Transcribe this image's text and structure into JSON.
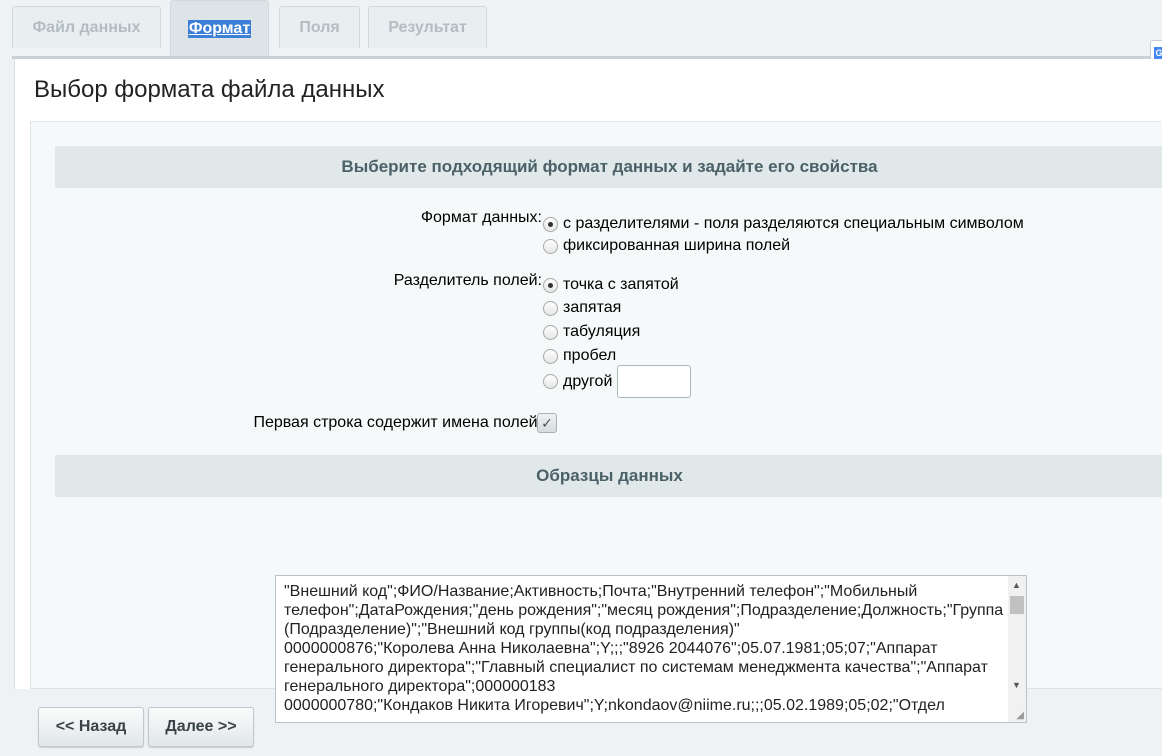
{
  "tabs": [
    {
      "label": "Файл данных",
      "active": false
    },
    {
      "label": "Формат",
      "active": true
    },
    {
      "label": "Поля",
      "active": false
    },
    {
      "label": "Результат",
      "active": false
    }
  ],
  "page": {
    "title": "Выбор формата файла данных"
  },
  "format_section": {
    "header": "Выберите подходящий формат данных и задайте его свойства",
    "format_label": "Формат данных:",
    "format_options": [
      {
        "label": "с разделителями - поля разделяются специальным символом",
        "checked": true
      },
      {
        "label": "фиксированная ширина полей",
        "checked": false
      }
    ],
    "separator_label": "Разделитель полей:",
    "separator_options": [
      {
        "label": "точка с запятой",
        "checked": true
      },
      {
        "label": "запятая",
        "checked": false
      },
      {
        "label": "табуляция",
        "checked": false
      },
      {
        "label": "пробел",
        "checked": false
      },
      {
        "label": "другой",
        "checked": false
      }
    ],
    "other_value": "",
    "first_row_label": "Первая строка содержит имена полей:",
    "first_row_checked": true
  },
  "samples_section": {
    "header": "Образцы данных",
    "text": "\"Внешний код\";ФИО/Название;Активность;Почта;\"Внутренний телефон\";\"Мобильный телефон\";ДатаРождения;\"день рождения\";\"месяц рождения\";Подразделение;Должность;\"Группа (Подразделение)\";\"Внешний код группы(код подразделения)\"\n0000000876;\"Королева Анна Николаевна\";Y;;;\"8926 2044076\";05.07.1981;05;07;\"Аппарат генерального директора\";\"Главный специалист по системам менеджмента качества\";\"Аппарат генерального директора\";000000183\n0000000780;\"Кондаков Никита Игоревич\";Y;nkondaov@niime.ru;;;05.02.1989;05;02;\"Отдел"
  },
  "buttons": {
    "back": "<< Назад",
    "next": "Далее >>"
  },
  "icons": {
    "translate": "G"
  }
}
